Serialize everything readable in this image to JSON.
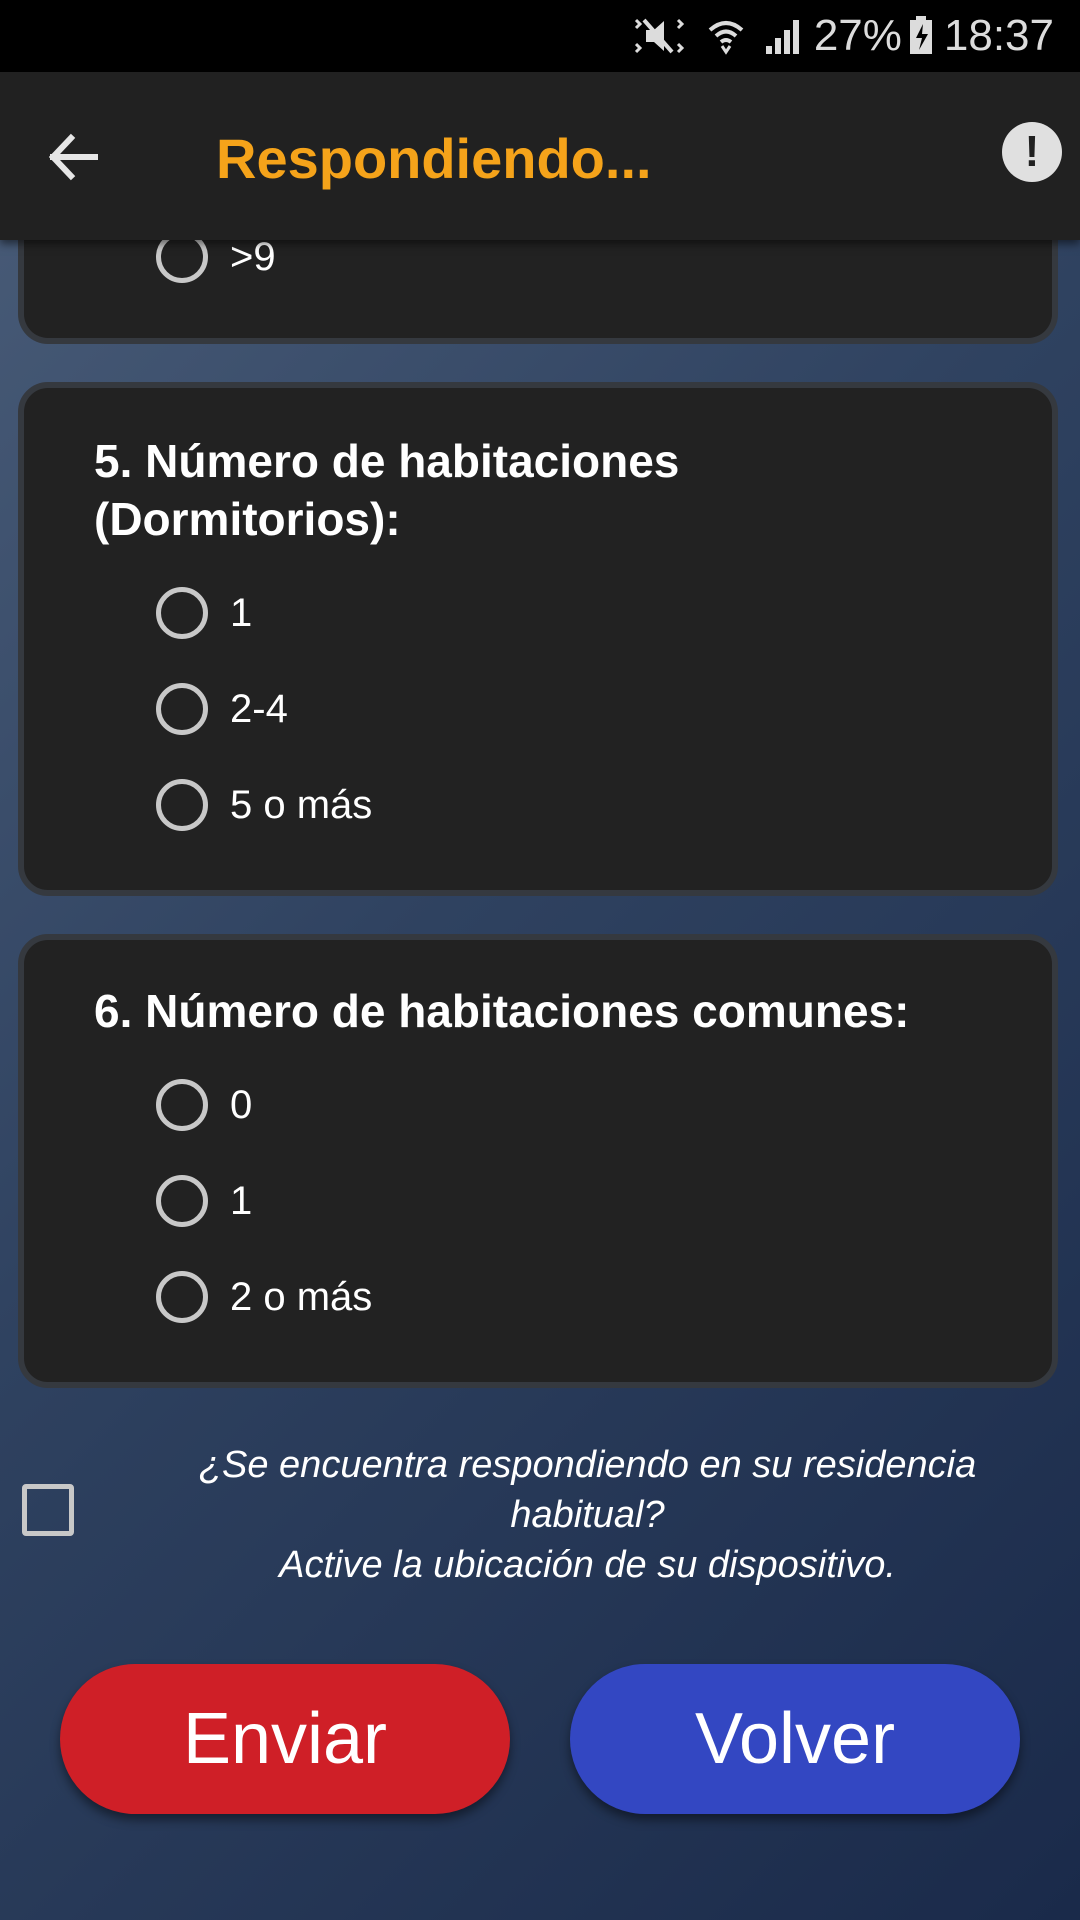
{
  "status_bar": {
    "icons": [
      "mute-vibrate-icon",
      "wifi-icon",
      "signal-icon",
      "battery-charging-icon"
    ],
    "battery": "27%",
    "time": "18:37"
  },
  "app_bar": {
    "title": "Respondiendo...",
    "back_icon": "arrow-left-icon",
    "info_icon": "exclamation-icon",
    "title_color": "#f5a31a"
  },
  "previous_card": {
    "options": [
      ">9"
    ]
  },
  "questions": [
    {
      "title_line1": "5. Número de habitaciones",
      "title_line2": "(Dormitorios):",
      "options": [
        "1",
        "2-4",
        "5 o más"
      ]
    },
    {
      "title_line1": "6. Número de habitaciones comunes:",
      "options": [
        "0",
        "1",
        "2 o más"
      ]
    }
  ],
  "location": {
    "line1": "¿Se encuentra respondiendo en su residencia",
    "line2": "habitual?",
    "line3": "Active la ubicación de su dispositivo.",
    "checked": false
  },
  "buttons": {
    "send": "Enviar",
    "back": "Volver",
    "send_color": "#cf1f27",
    "back_color": "#3347c2"
  }
}
